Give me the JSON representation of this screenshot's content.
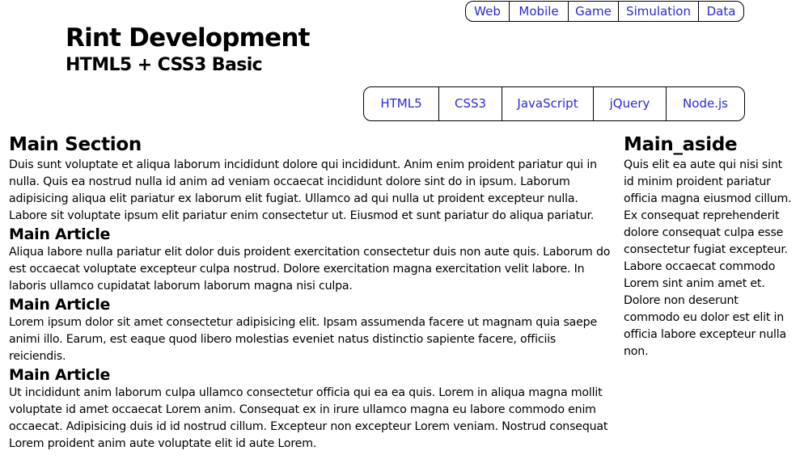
{
  "header": {
    "title": "Rint Development",
    "subtitle": "HTML5 + CSS3 Basic"
  },
  "top_nav": [
    "Web",
    "Mobile",
    "Game",
    "Simulation",
    "Data"
  ],
  "main_nav": [
    "HTML5",
    "CSS3",
    "JavaScript",
    "jQuery",
    "Node.js"
  ],
  "main_section": {
    "heading": "Main Section",
    "text": "Duis sunt voluptate et aliqua laborum incididunt dolore qui incididunt. Anim enim proident pariatur qui in nulla. Quis ea nostrud nulla id anim ad veniam occaecat incididunt dolore sint do in ipsum. Laborum adipisicing aliqua elit pariatur ex laborum elit fugiat. Ullamco ad qui nulla ut proident excepteur nulla. Labore sit voluptate ipsum elit pariatur enim consectetur ut. Eiusmod et sunt pariatur do aliqua pariatur.",
    "articles": [
      {
        "heading": "Main Article",
        "text": "Aliqua labore nulla pariatur elit dolor duis proident exercitation consectetur duis non aute quis. Laborum do est occaecat voluptate excepteur culpa nostrud. Dolore exercitation magna exercitation velit labore. In laboris ullamco cupidatat laborum laborum magna nisi culpa."
      },
      {
        "heading": "Main Article",
        "text": "Lorem ipsum dolor sit amet consectetur adipisicing elit. Ipsam assumenda facere ut magnam quia saepe animi illo. Earum, est eaque quod libero molestias eveniet natus distinctio sapiente facere, officiis reiciendis."
      },
      {
        "heading": "Main Article",
        "text": "Ut incididunt anim laborum culpa ullamco consectetur officia qui ea ea quis. Lorem in aliqua magna mollit voluptate id amet occaecat Lorem anim. Consequat ex in irure ullamco magna eu labore commodo enim occaecat. Adipisicing duis id id nostrud cillum. Excepteur non excepteur Lorem veniam. Nostrud consequat Lorem proident anim aute voluptate elit id aute Lorem."
      }
    ]
  },
  "aside": {
    "heading": "Main_aside",
    "text": "Quis elit ea aute qui nisi sint id minim proident pariatur officia magna eiusmod cillum. Ex consequat reprehenderit dolore consequat culpa esse consectetur fugiat excepteur. Labore occaecat commodo Lorem sint anim amet et. Dolore non deserunt commodo eu dolor est elit in officia labore excepteur nulla non."
  },
  "colors": {
    "link": "#2a2ad6",
    "border": "#000000",
    "text": "#000000",
    "background": "#ffffff"
  }
}
